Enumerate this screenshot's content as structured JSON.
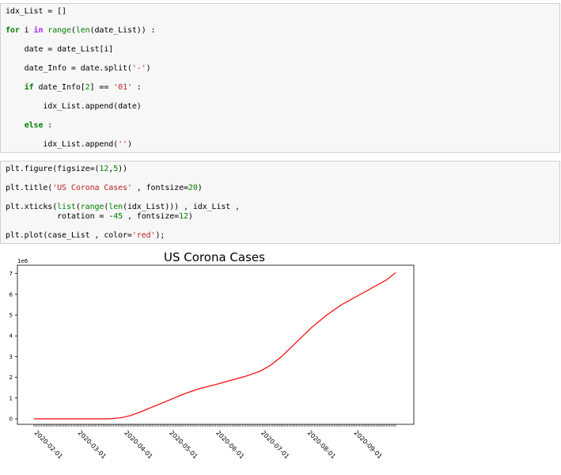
{
  "cell1": {
    "lines": [
      [
        {
          "t": "idx_List = []",
          "c": ""
        }
      ],
      [
        {
          "t": "for",
          "c": "kw"
        },
        {
          "t": " i ",
          "c": ""
        },
        {
          "t": "in",
          "c": "op"
        },
        {
          "t": " ",
          "c": ""
        },
        {
          "t": "range",
          "c": "bi"
        },
        {
          "t": "(",
          "c": ""
        },
        {
          "t": "len",
          "c": "bi"
        },
        {
          "t": "(date_List)) :",
          "c": ""
        }
      ],
      [
        {
          "t": "    date = date_List[i]",
          "c": ""
        }
      ],
      [
        {
          "t": "    date_Info = date.split(",
          "c": ""
        },
        {
          "t": "'-'",
          "c": "str"
        },
        {
          "t": ")",
          "c": ""
        }
      ],
      [
        {
          "t": "    ",
          "c": ""
        },
        {
          "t": "if",
          "c": "kw"
        },
        {
          "t": " date_Info[",
          "c": ""
        },
        {
          "t": "2",
          "c": "num"
        },
        {
          "t": "] == ",
          "c": ""
        },
        {
          "t": "'01'",
          "c": "str"
        },
        {
          "t": " :",
          "c": ""
        }
      ],
      [
        {
          "t": "        idx_List.append(date)",
          "c": ""
        }
      ],
      [
        {
          "t": "    ",
          "c": ""
        },
        {
          "t": "else",
          "c": "kw"
        },
        {
          "t": " :",
          "c": ""
        }
      ],
      [
        {
          "t": "        idx_List.append(",
          "c": ""
        },
        {
          "t": "''",
          "c": "str"
        },
        {
          "t": ")",
          "c": ""
        }
      ]
    ]
  },
  "cell2": {
    "lines": [
      [
        {
          "t": "plt.figure(figsize=(",
          "c": ""
        },
        {
          "t": "12",
          "c": "num"
        },
        {
          "t": ",",
          "c": ""
        },
        {
          "t": "5",
          "c": "num"
        },
        {
          "t": "))",
          "c": ""
        }
      ],
      [
        {
          "t": "plt.title(",
          "c": ""
        },
        {
          "t": "'US Corona Cases'",
          "c": "str"
        },
        {
          "t": " , fontsize=",
          "c": ""
        },
        {
          "t": "20",
          "c": "num"
        },
        {
          "t": ")",
          "c": ""
        }
      ],
      [
        {
          "t": "plt.xticks(",
          "c": ""
        },
        {
          "t": "list",
          "c": "bi"
        },
        {
          "t": "(",
          "c": ""
        },
        {
          "t": "range",
          "c": "bi"
        },
        {
          "t": "(",
          "c": ""
        },
        {
          "t": "len",
          "c": "bi"
        },
        {
          "t": "(idx_List))) , idx_List ,",
          "c": ""
        }
      ],
      [
        {
          "t": "           rotation = -",
          "c": ""
        },
        {
          "t": "45",
          "c": "num"
        },
        {
          "t": " , fontsize=",
          "c": ""
        },
        {
          "t": "12",
          "c": "num"
        },
        {
          "t": ")",
          "c": ""
        }
      ],
      [
        {
          "t": "plt.plot(case_List , color=",
          "c": ""
        },
        {
          "t": "'red'",
          "c": "str"
        },
        {
          "t": ");",
          "c": ""
        }
      ]
    ]
  },
  "chart_data": {
    "type": "line",
    "title": "US Corona Cases",
    "offset_text": "1e6",
    "xlabel": "",
    "ylabel": "",
    "ylim": [
      -0.35,
      7.45
    ],
    "yticks": [
      0,
      1,
      2,
      3,
      4,
      5,
      6,
      7
    ],
    "x_tick_labels": [
      "2020-02-01",
      "2020-03-01",
      "2020-04-01",
      "2020-05-01",
      "2020-06-01",
      "2020-07-01",
      "2020-08-01",
      "2020-09-01"
    ],
    "x_label_day_index": [
      0,
      29,
      60,
      90,
      121,
      151,
      182,
      213
    ],
    "total_days": 242,
    "line_color": "#ff0000",
    "series": [
      {
        "values_day_index": [
          0,
          30,
          50,
          58,
          64,
          70,
          80,
          90,
          100,
          110,
          121,
          131,
          141,
          151,
          158,
          165,
          175,
          185,
          195,
          205,
          215,
          225,
          235,
          241
        ],
        "values_millions": [
          0.0,
          0.0,
          0.0,
          0.05,
          0.15,
          0.3,
          0.6,
          0.9,
          1.2,
          1.45,
          1.65,
          1.85,
          2.05,
          2.3,
          2.6,
          3.0,
          3.7,
          4.4,
          5.0,
          5.5,
          5.9,
          6.3,
          6.7,
          7.05
        ]
      }
    ]
  }
}
